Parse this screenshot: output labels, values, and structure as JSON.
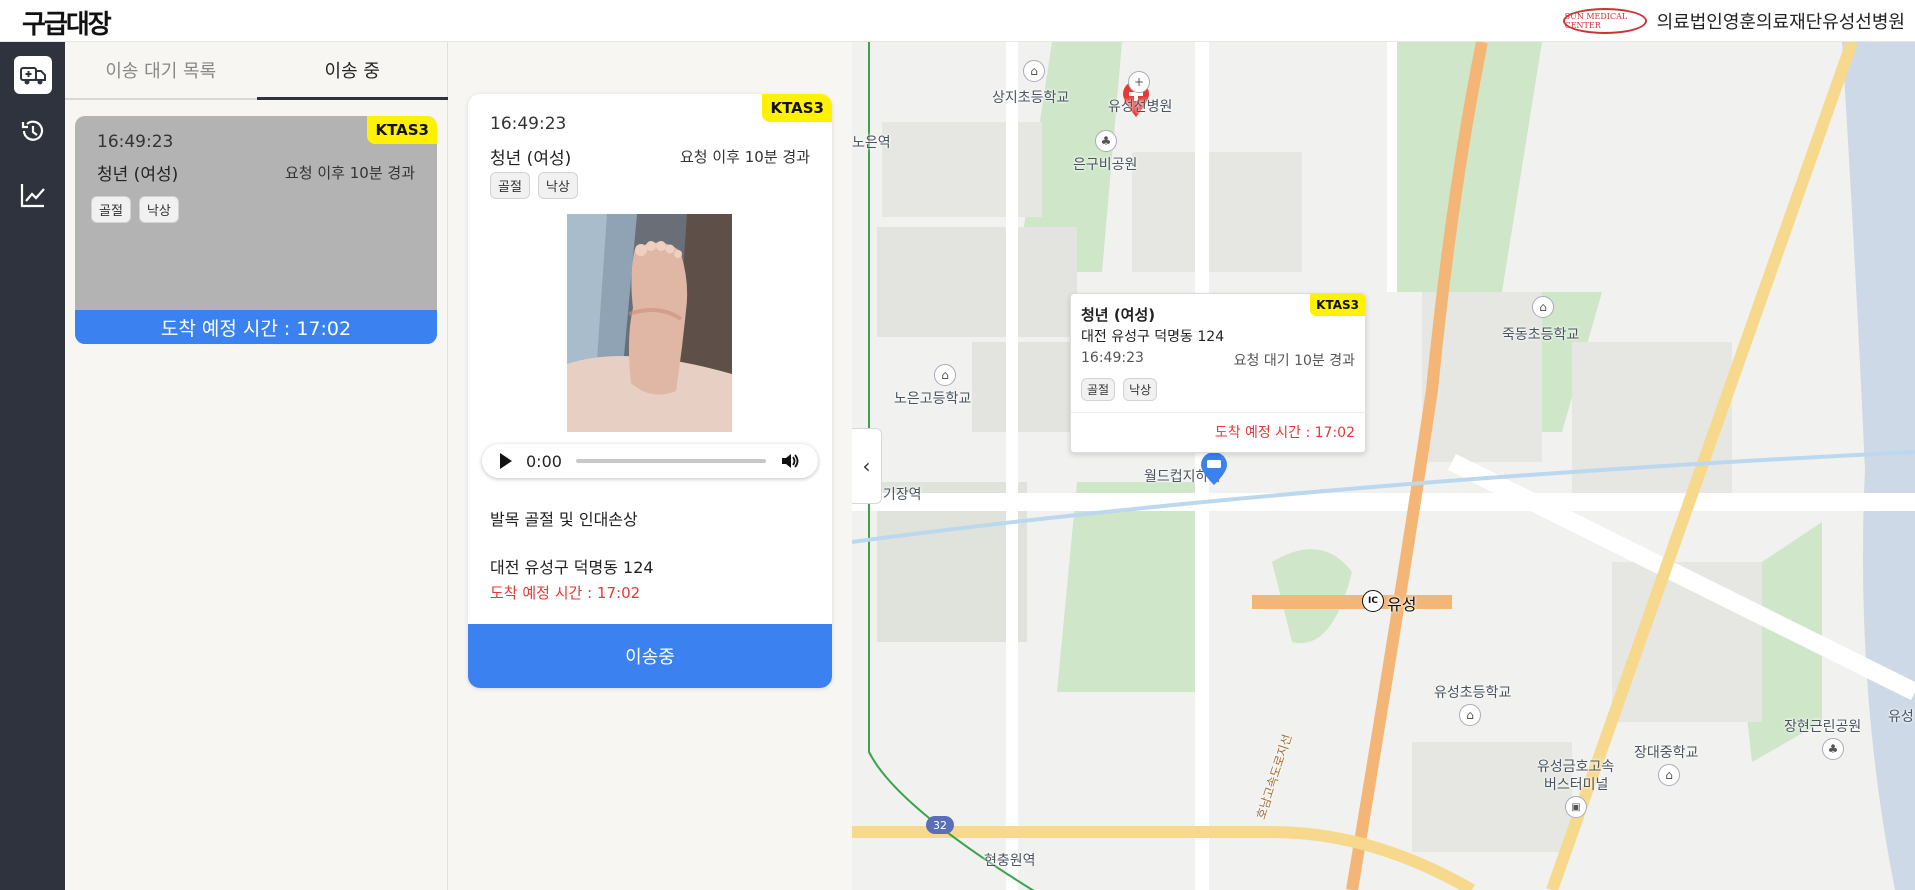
{
  "app": {
    "logo": "구급대장"
  },
  "hospital": {
    "logo_text": "SUN MEDICAL CENTER",
    "name": "의료법인영훈의료재단유성선병원"
  },
  "rail": {
    "items": [
      "ambulance-icon",
      "history-icon",
      "chart-line-icon"
    ]
  },
  "tabs": [
    {
      "label": "이송 대기 목록"
    },
    {
      "label": "이송 중"
    }
  ],
  "patient_card": {
    "ktas": "KTAS3",
    "time": "16:49:23",
    "name": "청년 (여성)",
    "elapsed": "요청 이후 10분 경과",
    "tags": [
      "골절",
      "낙상"
    ],
    "eta": "도착 예정 시간 : 17:02"
  },
  "detail": {
    "ktas": "KTAS3",
    "time": "16:49:23",
    "name": "청년 (여성)",
    "elapsed": "요청 이후 10분 경과",
    "tags": [
      "골절",
      "낙상"
    ],
    "audio_time": "0:00",
    "description": "발목 골절 및 인대손상",
    "address": "대전 유성구 덕명동 124",
    "eta": "도착 예정 시간 : 17:02",
    "action": "이송중"
  },
  "map": {
    "popup": {
      "ktas": "KTAS3",
      "name": "청년 (여성)",
      "address": "대전 유성구 덕명동 124",
      "time": "16:49:23",
      "elapsed": "요청 대기 10분 경과",
      "tags": [
        "골절",
        "낙상"
      ],
      "eta": "도착 예정 시간 : 17:02"
    },
    "labels": {
      "sangji": "상지초등학교",
      "hospital": "유성선병원",
      "neun_station": "노은역",
      "eungu_park": "은구비공원",
      "neun_high": "노은고등학교",
      "jukdong": "죽동초등학교",
      "worldcup": "월드컵지하차",
      "jang_station": "경기장역",
      "yuseong_ic": "유성",
      "ic": "IC",
      "yuseong_elem": "유성초등학교",
      "janghyeon_park": "장현근린공원",
      "yuseong_edge": "유성",
      "jangdae_mid": "장대중학교",
      "bus_terminal_1": "유성금호고속",
      "bus_terminal_2": "버스터미널",
      "hyeonchungwon": "현충원역",
      "route_32": "32",
      "expressway": "호남고속도로지선"
    }
  }
}
